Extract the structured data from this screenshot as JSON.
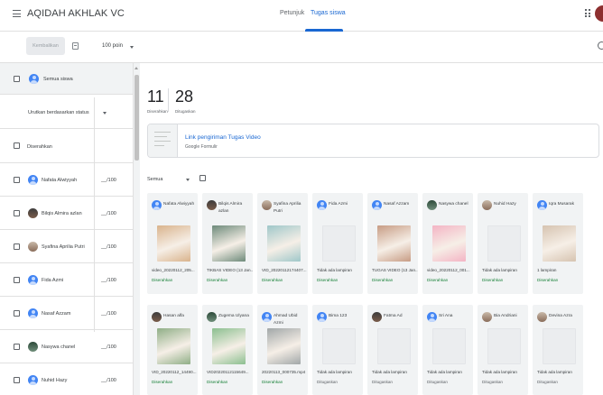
{
  "header": {
    "class_title": "AQIDAH AKHLAK VC",
    "tabs": [
      {
        "label": "Petunjuk",
        "active": false
      },
      {
        "label": "Tugas siswa",
        "active": true
      }
    ],
    "accent_color": "#1967d2"
  },
  "toolbar": {
    "return_label": "Kembalikan",
    "points_value": "100 poin"
  },
  "left_panel": {
    "all_students_label": "Semua siswa",
    "sort_label": "Urutkan berdasarkan status",
    "section_label": "Diserahkan",
    "students": [
      {
        "name": "Nafata Alwiyyah",
        "grade": "__/100",
        "avatar": "blue"
      },
      {
        "name": "Bilqis Almira azlan",
        "grade": "__/100",
        "avatar": "photo1"
      },
      {
        "name": "Syafina Aprilia Putri",
        "grade": "__/100",
        "avatar": "photo2"
      },
      {
        "name": "Fida Azmi",
        "grade": "__/100",
        "avatar": "blue"
      },
      {
        "name": "Nasaf Azzam",
        "grade": "__/100",
        "avatar": "blue"
      },
      {
        "name": "Nasywa chanel",
        "grade": "__/100",
        "avatar": "photo3"
      },
      {
        "name": "Nuhid Hazy",
        "grade": "__/100",
        "avatar": "blue"
      }
    ]
  },
  "summary": {
    "submitted_count": "11",
    "submitted_label": "Diserahkan",
    "assigned_count": "28",
    "assigned_label": "Ditugaskan"
  },
  "attachment": {
    "title": "Link pengiriman Tugas Video",
    "subtitle": "Google Formulir"
  },
  "filter": {
    "label": "Semua"
  },
  "cards": [
    {
      "name": "Nafata Alwiyyah",
      "avatar": "blue",
      "file": "video_20220112_205...",
      "status": "Diserahkan",
      "media": "photo",
      "shade": "#d9b38c"
    },
    {
      "name": "Bilqis Almira azlan",
      "avatar": "photo1",
      "file": "TIKBAS VIDEO (13 Jan...",
      "status": "Diserahkan",
      "media": "photo",
      "shade": "#6d8a7a"
    },
    {
      "name": "Syafina Aprilia Putri",
      "avatar": "photo2",
      "file": "VID_20220112174407...",
      "status": "Diserahkan",
      "media": "photo",
      "shade": "#9fc7c9"
    },
    {
      "name": "Fida Azmi",
      "avatar": "blue",
      "file": "Tidak ada lampiran",
      "status": "Diserahkan",
      "media": "empty"
    },
    {
      "name": "Nasaf Azzam",
      "avatar": "blue",
      "file": "TUGAS VIDEO (13 Jan...",
      "status": "Diserahkan",
      "media": "photo",
      "shade": "#c79c84"
    },
    {
      "name": "Nasywa chanel",
      "avatar": "photo3",
      "file": "video_20220112_001...",
      "status": "Diserahkan",
      "media": "photo",
      "shade": "#f4b4c4"
    },
    {
      "name": "Nuhid Hazy",
      "avatar": "photo2",
      "file": "Tidak ada lampiran",
      "status": "Diserahkan",
      "media": "empty"
    },
    {
      "name": "Iqra Musarak",
      "avatar": "blue",
      "file": "1 lampiran",
      "status": "Diserahkan",
      "media": "photo",
      "shade": "#d6c3b0"
    },
    {
      "name": "Hasan alfa",
      "avatar": "photo1",
      "file": "VID_20220112_14490...",
      "status": "Diserahkan",
      "media": "photo",
      "shade": "#8fae86"
    },
    {
      "name": "Zugema Ulyana",
      "avatar": "photo3",
      "file": "VID20220112115649...",
      "status": "Diserahkan",
      "media": "photo",
      "shade": "#8bbf8f"
    },
    {
      "name": "Ahmad Ubid Azmi",
      "avatar": "blue",
      "file": "20220113_000735.mp4",
      "status": "Diserahkan",
      "media": "photo",
      "shade": "#a1a7a8"
    },
    {
      "name": "Bima 123",
      "avatar": "blue",
      "file": "Tidak ada lampiran",
      "status": "Ditugaskan",
      "media": "empty"
    },
    {
      "name": "Fatma Ad",
      "avatar": "photo1",
      "file": "Tidak ada lampiran",
      "status": "Ditugaskan",
      "media": "empty"
    },
    {
      "name": "Sri Ana",
      "avatar": "blue",
      "file": "Tidak ada lampiran",
      "status": "Ditugaskan",
      "media": "empty"
    },
    {
      "name": "Bia Andriani",
      "avatar": "photo2",
      "file": "Tidak ada lampiran",
      "status": "Ditugaskan",
      "media": "empty"
    },
    {
      "name": "Devina Azra",
      "avatar": "photo2",
      "file": "Tidak ada lampiran",
      "status": "Ditugaskan",
      "media": "empty"
    }
  ]
}
